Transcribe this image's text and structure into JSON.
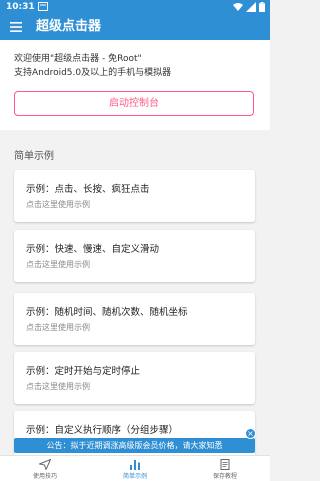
{
  "status_bar": {
    "time": "10:31"
  },
  "app_bar": {
    "title": "超级点击器"
  },
  "intro": {
    "line1": "欢迎使用\"超级点击器 - 免Root\"",
    "line2": "支持Android5.0及以上的手机与模拟器"
  },
  "console_button": "启动控制台",
  "section_title": "简单示例",
  "cards": [
    {
      "title": "示例：点击、长按、疯狂点击",
      "subtitle": "点击这里使用示例"
    },
    {
      "title": "示例：快速、慢速、自定义滑动",
      "subtitle": "点击这里使用示例"
    },
    {
      "title": "示例：随机时间、随机次数、随机坐标",
      "subtitle": "点击这里使用示例"
    },
    {
      "title": "示例：定时开始与定时停止",
      "subtitle": "点击这里使用示例"
    },
    {
      "title": "示例：自定义执行顺序（分组步骤）",
      "subtitle": ""
    }
  ],
  "announcement": "公告：拟于近期调涨高级版会员价格，请大家知悉",
  "announcement_close": "×",
  "bottom_nav": [
    {
      "label": "使用技巧",
      "icon": "send-icon"
    },
    {
      "label": "简单示例",
      "icon": "bar-chart-icon"
    },
    {
      "label": "保存教程",
      "icon": "document-icon"
    }
  ],
  "colors": {
    "primary": "#2f8fd4",
    "accent": "#ff5b84",
    "background": "#f2f2f2"
  }
}
